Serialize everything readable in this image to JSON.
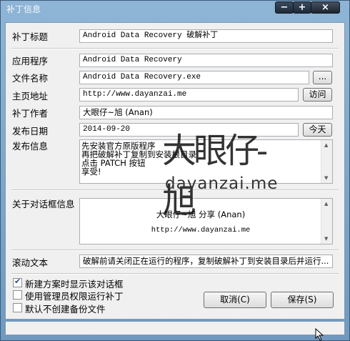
{
  "window": {
    "title": "补丁信息",
    "min": "−",
    "max": "+",
    "close": "×"
  },
  "fields": {
    "patch_title_label": "补丁标题",
    "patch_title_value": "Android Data Recovery 破解补丁",
    "app_label": "应用程序",
    "app_value": "Android Data Recovery",
    "filename_label": "文件名称",
    "filename_value": "Android Data Recovery.exe",
    "browse_label": "...",
    "homepage_label": "主页地址",
    "homepage_value": "http://www.dayanzai.me",
    "visit_label": "访问",
    "author_label": "补丁作者",
    "author_value": "大眼仔~旭 (Anan)",
    "date_label": "发布日期",
    "date_value": "2014-09-20",
    "today_label": "今天",
    "info_label": "发布信息",
    "info_lines": [
      "先安装官方原版程序",
      "再把破解补丁复制到安装根目录",
      "点击 PATCH 按钮",
      "享受!"
    ],
    "about_label": "关于对话框信息",
    "about_line1": "大眼仔~旭 分享 (Anan)",
    "about_line2": "http://www.dayanzai.me",
    "scroll_label": "滚动文本",
    "scroll_value": "破解前请关闭正在运行的程序，复制破解补丁到安装目录后并运行..."
  },
  "options": [
    {
      "label": "新建方案时显示该对话框",
      "checked": true
    },
    {
      "label": "使用管理员权限运行补丁",
      "checked": false
    },
    {
      "label": "默认不创建备份文件",
      "checked": false
    }
  ],
  "buttons": {
    "cancel": "取消(C)",
    "save": "保存(S)"
  },
  "watermark": {
    "logo_text": "大眼仔-旭",
    "domain": "dayanzai.me"
  }
}
